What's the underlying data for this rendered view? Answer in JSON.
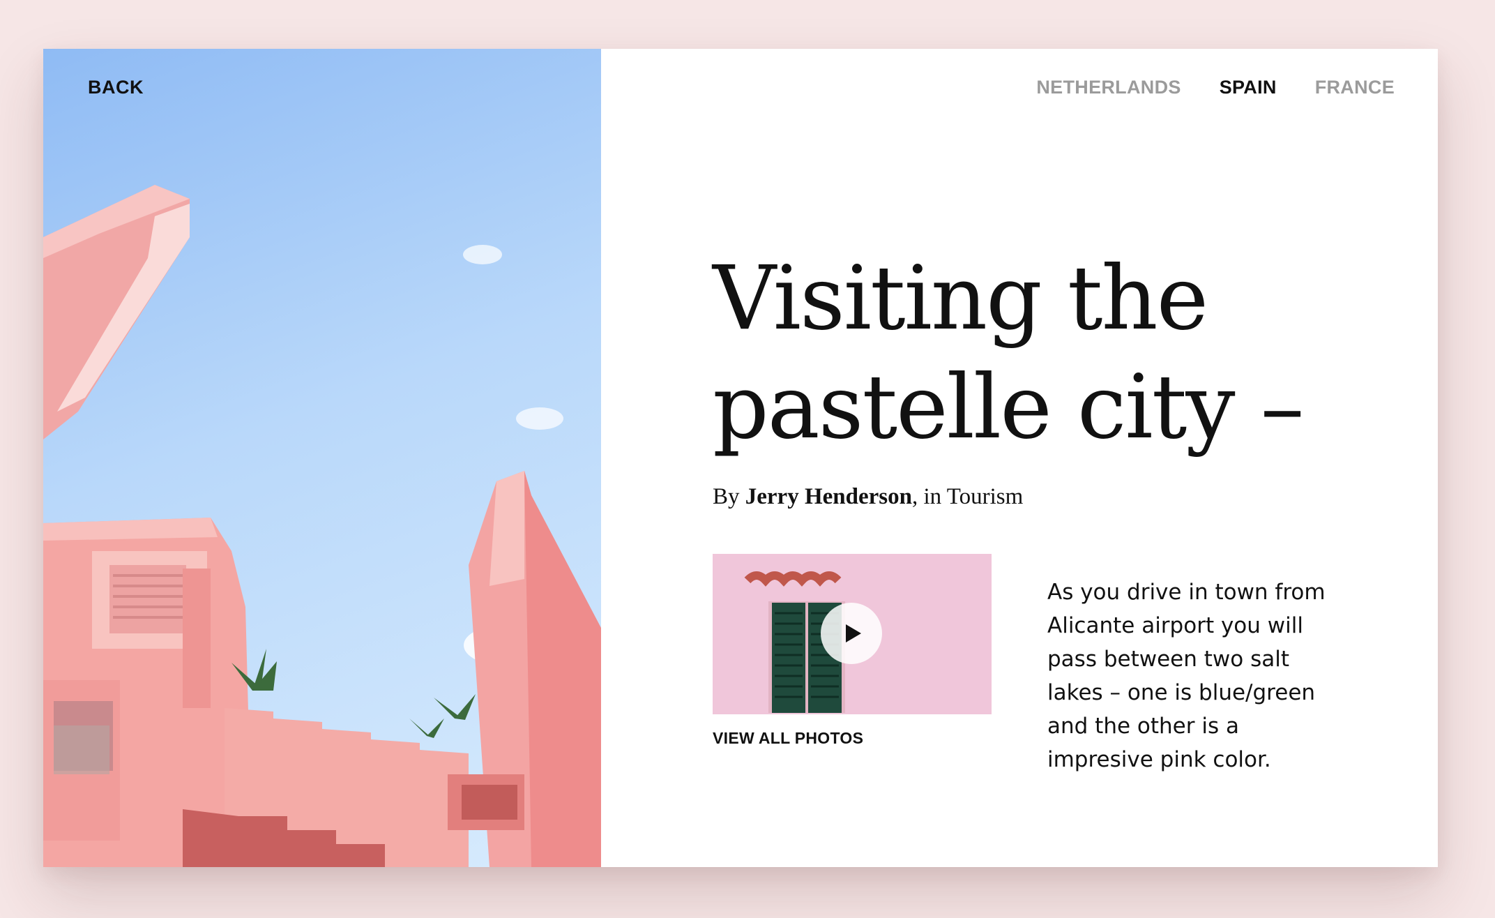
{
  "nav": {
    "back_label": "BACK",
    "countries": [
      {
        "label": "NETHERLANDS",
        "active": false
      },
      {
        "label": "SPAIN",
        "active": true
      },
      {
        "label": "FRANCE",
        "active": false
      }
    ]
  },
  "article": {
    "title_line1": "Visiting the",
    "title_line2": "pastelle city –",
    "byline_prefix": "By ",
    "author": "Jerry Henderson",
    "byline_sep": ", in ",
    "category": "Tourism",
    "body": "As you drive in town from Alicante airport you will pass between two salt lakes – one is blue/green and the other is a impresive pink color.",
    "view_photos_label": "VIEW ALL PHOTOS"
  },
  "colors": {
    "page_bg": "#f6e6e6",
    "card_bg": "#ffffff",
    "active_nav": "#111111",
    "inactive_nav": "#9b9b9b",
    "building_pink": "#f3a3a2",
    "sky_blue": "#a9cdf8",
    "shutter_green": "#1f4a3c"
  },
  "icons": {
    "play": "play-icon"
  }
}
